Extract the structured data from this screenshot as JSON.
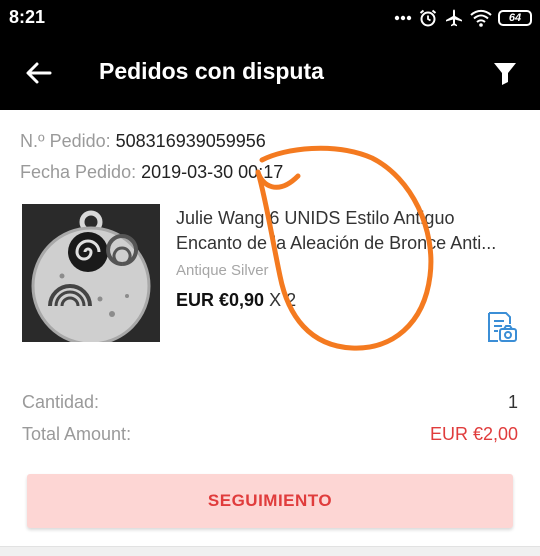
{
  "status_bar": {
    "time": "8:21",
    "battery": "64"
  },
  "toolbar": {
    "title": "Pedidos con disputa"
  },
  "order": {
    "order_no_label": "N.º Pedido:",
    "order_no": "508316939059956",
    "date_label": "Fecha Pedido:",
    "date": "2019-03-30 00:17"
  },
  "product": {
    "name_line1": "Julie Wang 6 UNIDS Estilo Antiguo",
    "name_line2": "Encanto de la Aleación de Bronce Anti...",
    "variant": "Antique Silver",
    "price": "EUR €0,90",
    "qty_mult": "X 2"
  },
  "summary": {
    "quantity_label": "Cantidad:",
    "quantity": "1",
    "total_label": "Total Amount:",
    "total": "EUR €2,00"
  },
  "actions": {
    "track_label": "SEGUIMIENTO"
  },
  "colors": {
    "accent_red": "#e03c3c",
    "button_bg": "#fdd6d4",
    "annotation_orange": "#f47a20"
  }
}
